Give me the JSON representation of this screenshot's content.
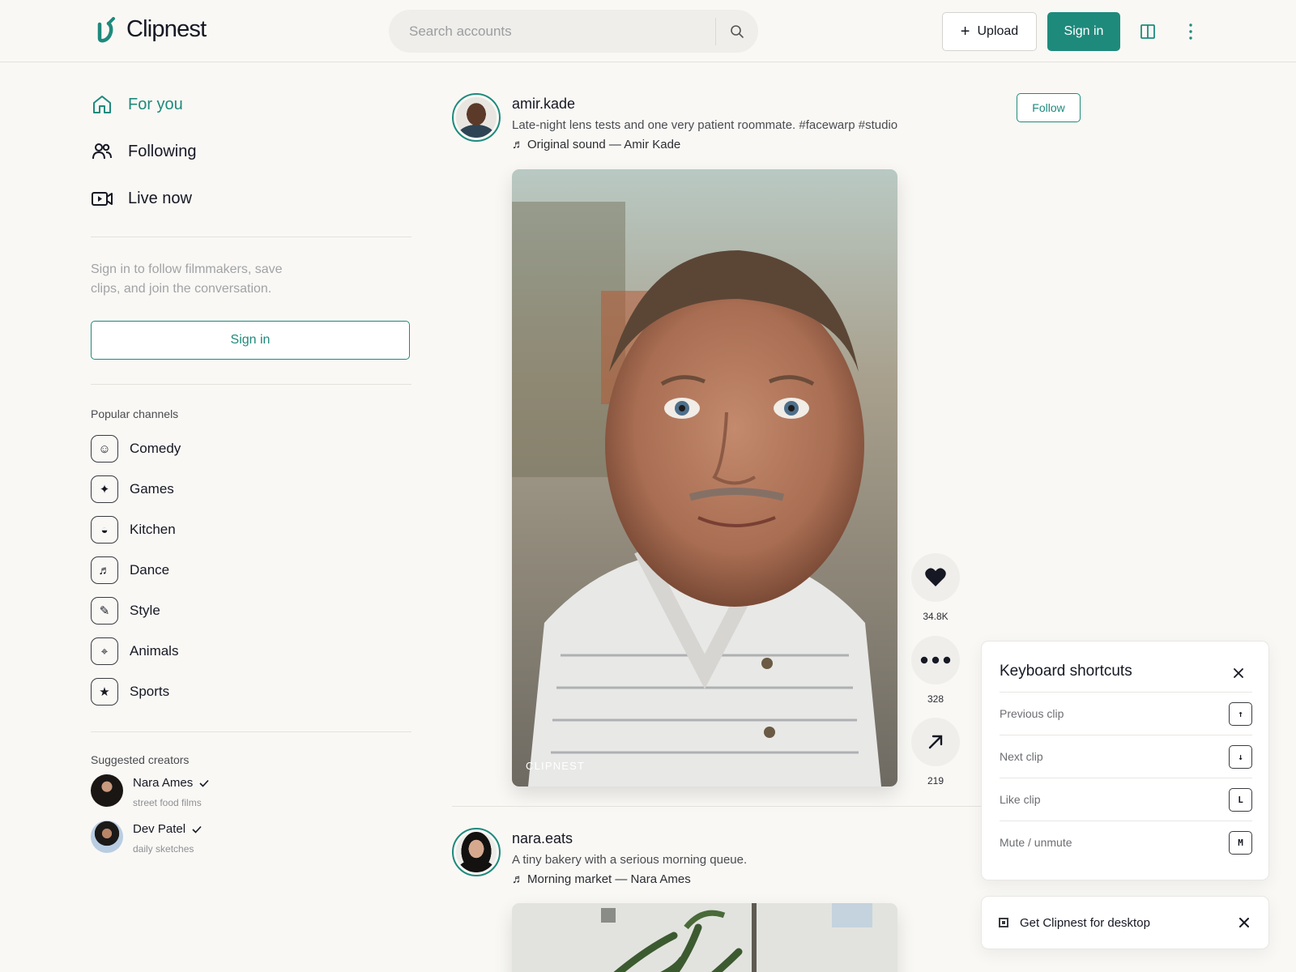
{
  "brand": {
    "name": "Clipnest",
    "accent": "#1e8a7c"
  },
  "header": {
    "search_placeholder": "Search accounts",
    "upload_label": "Upload",
    "signin_label": "Sign in"
  },
  "sidebar": {
    "nav": [
      {
        "label": "For you",
        "icon": "home-icon",
        "active": true
      },
      {
        "label": "Following",
        "icon": "people-icon",
        "active": false
      },
      {
        "label": "Live now",
        "icon": "live-camera-icon",
        "active": false
      }
    ],
    "signin_note": "Sign in to follow filmmakers, save clips, and join the conversation.",
    "signin_button": "Sign in",
    "channels_title": "Popular channels",
    "channels": [
      {
        "label": "Comedy",
        "glyph": "☺"
      },
      {
        "label": "Games",
        "glyph": "✦"
      },
      {
        "label": "Kitchen",
        "glyph": "◒"
      },
      {
        "label": "Dance",
        "glyph": "♬"
      },
      {
        "label": "Style",
        "glyph": "✎"
      },
      {
        "label": "Animals",
        "glyph": "⌖"
      },
      {
        "label": "Sports",
        "glyph": "★"
      }
    ],
    "creators_title": "Suggested creators",
    "creators": [
      {
        "name": "Nara Ames",
        "sub": "street food films",
        "verified": true
      },
      {
        "name": "Dev Patel",
        "sub": "daily sketches",
        "verified": true
      }
    ]
  },
  "feed": {
    "posts": [
      {
        "username": "amir.kade",
        "caption": "Late-night lens tests and one very patient roommate.",
        "hashtags": "#facewarp #studio",
        "sound": "Original sound — Amir Kade",
        "follow_label": "Follow",
        "watermark": "CLIPNEST",
        "likes": "34.8K",
        "comments": "328",
        "shares": "219"
      },
      {
        "username": "nara.eats",
        "caption": "A tiny bakery with a serious morning queue.",
        "sound": "Morning market — Nara Ames"
      }
    ]
  },
  "shortcuts": {
    "title": "Keyboard shortcuts",
    "items": [
      {
        "label": "Previous clip",
        "key": "↑"
      },
      {
        "label": "Next clip",
        "key": "↓"
      },
      {
        "label": "Like clip",
        "key": "L"
      },
      {
        "label": "Mute / unmute",
        "key": "M"
      }
    ]
  },
  "desktop_banner": {
    "label": "Get Clipnest for desktop"
  }
}
